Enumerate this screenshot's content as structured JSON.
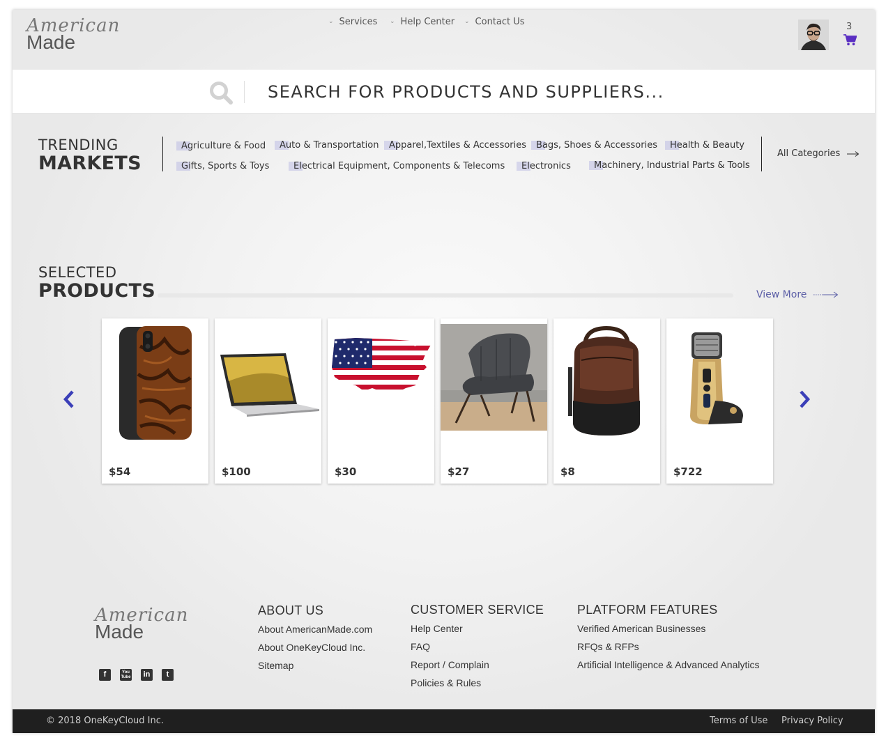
{
  "brand": {
    "script": "American",
    "word": "Made"
  },
  "nav": {
    "items": [
      {
        "label": "Services"
      },
      {
        "label": "Help Center"
      },
      {
        "label": "Contact Us"
      }
    ],
    "cart_count": "3"
  },
  "search": {
    "placeholder": "SEARCH FOR PRODUCTS AND SUPPLIERS..."
  },
  "trending": {
    "title_small": "TRENDING",
    "title_big": "MARKETS",
    "categories": [
      "Agriculture & Food",
      "Auto & Transportation",
      "Apparel,Textiles & Accessories",
      "Bags, Shoes & Accessories",
      "Health & Beauty",
      "Gifts, Sports & Toys",
      "Electrical Equipment, Components & Telecoms",
      "Electronics",
      "Machinery, Industrial Parts & Tools"
    ],
    "all_categories": "All Categories"
  },
  "selected": {
    "title_small": "SELECTED",
    "title_big": "PRODUCTS",
    "view_more": "View More",
    "products": [
      {
        "image": "wood-phone-case",
        "price": "$54"
      },
      {
        "image": "laptop",
        "price": "$100"
      },
      {
        "image": "usa-flag-map",
        "price": "$30"
      },
      {
        "image": "lounge-chair",
        "price": "$27"
      },
      {
        "image": "leather-backpack",
        "price": "$8"
      },
      {
        "image": "electric-shaver",
        "price": "$722"
      }
    ]
  },
  "footer": {
    "about": {
      "title": "ABOUT US",
      "links": [
        "About AmericanMade.com",
        "About OneKeyCloud Inc.",
        "Sitemap"
      ]
    },
    "service": {
      "title": "CUSTOMER SERVICE",
      "links": [
        "Help Center",
        "FAQ",
        "Report / Complain",
        "Policies & Rules"
      ]
    },
    "features": {
      "title": "PLATFORM FEATURES",
      "links": [
        "Verified American Businesses",
        "RFQs & RFPs",
        "Artificial Intelligence & Advanced Analytics"
      ]
    },
    "social": [
      {
        "icon": "facebook-icon",
        "glyph": "f"
      },
      {
        "icon": "youtube-icon",
        "glyph": "You Tube"
      },
      {
        "icon": "linkedin-icon",
        "glyph": "in"
      },
      {
        "icon": "twitter-icon",
        "glyph": "t"
      }
    ],
    "copyright": "© 2018 OneKeyCloud Inc.",
    "terms": "Terms of Use",
    "privacy": "Privacy Policy"
  },
  "colors": {
    "accent": "#5a2fc2",
    "arrow": "#3b3fb8",
    "view_more": "#5b5ea6",
    "bottom_bar": "#1f1f1f"
  }
}
